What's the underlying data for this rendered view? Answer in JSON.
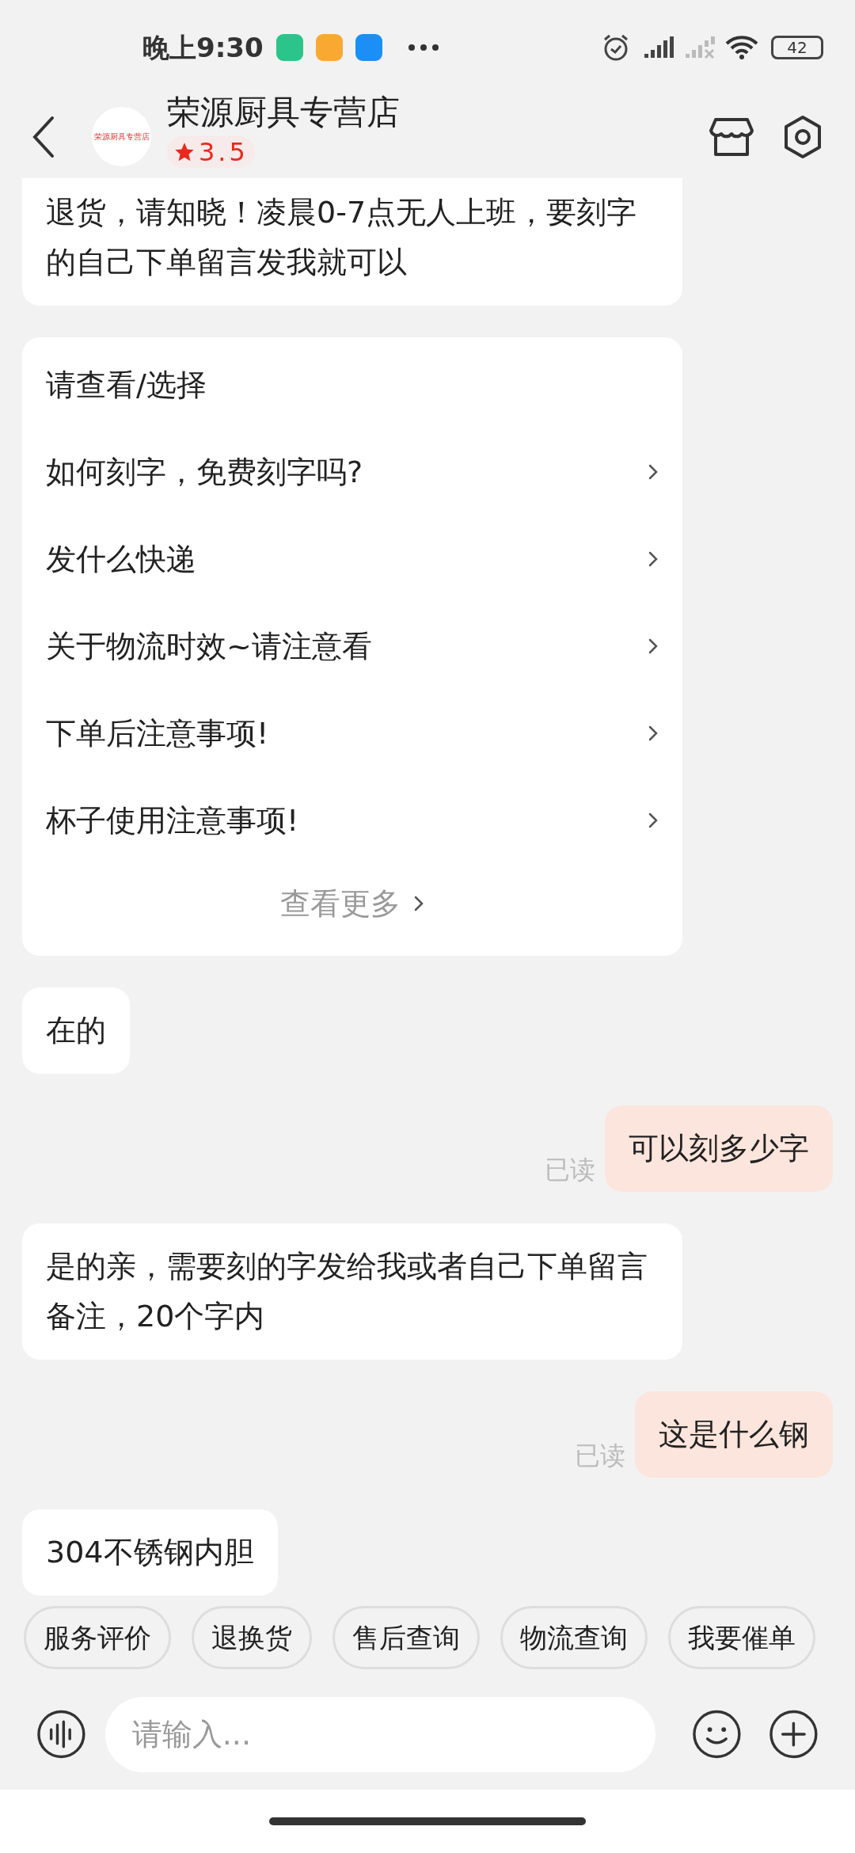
{
  "status_bar": {
    "time": "晚上9:30",
    "battery": "42"
  },
  "header": {
    "shop_name": "荣源厨具专营店",
    "avatar_text": "荣源厨具专营店",
    "rating": "3.5"
  },
  "messages": [
    {
      "kind": "received",
      "text": "退货，请知晓！凌晨0-7点无人上班，要刻字的自己下单留言发我就可以"
    },
    {
      "kind": "menu",
      "title": "请查看/选择",
      "items": [
        "如何刻字，免费刻字吗?",
        "发什么快递",
        "关于物流时效~请注意看",
        "下单后注意事项!",
        "杯子使用注意事项!"
      ],
      "more": "查看更多"
    },
    {
      "kind": "received",
      "text": "在的"
    },
    {
      "kind": "sent",
      "text": "可以刻多少字",
      "receipt": "已读"
    },
    {
      "kind": "received",
      "text": "是的亲，需要刻的字发给我或者自己下单留言备注，20个字内"
    },
    {
      "kind": "sent",
      "text": "这是什么钢",
      "receipt": "已读"
    },
    {
      "kind": "received",
      "text": "304不锈钢内胆"
    }
  ],
  "quick_replies": [
    "服务评价",
    "退换货",
    "售后查询",
    "物流查询",
    "我要催单"
  ],
  "input": {
    "placeholder": "请输入..."
  }
}
